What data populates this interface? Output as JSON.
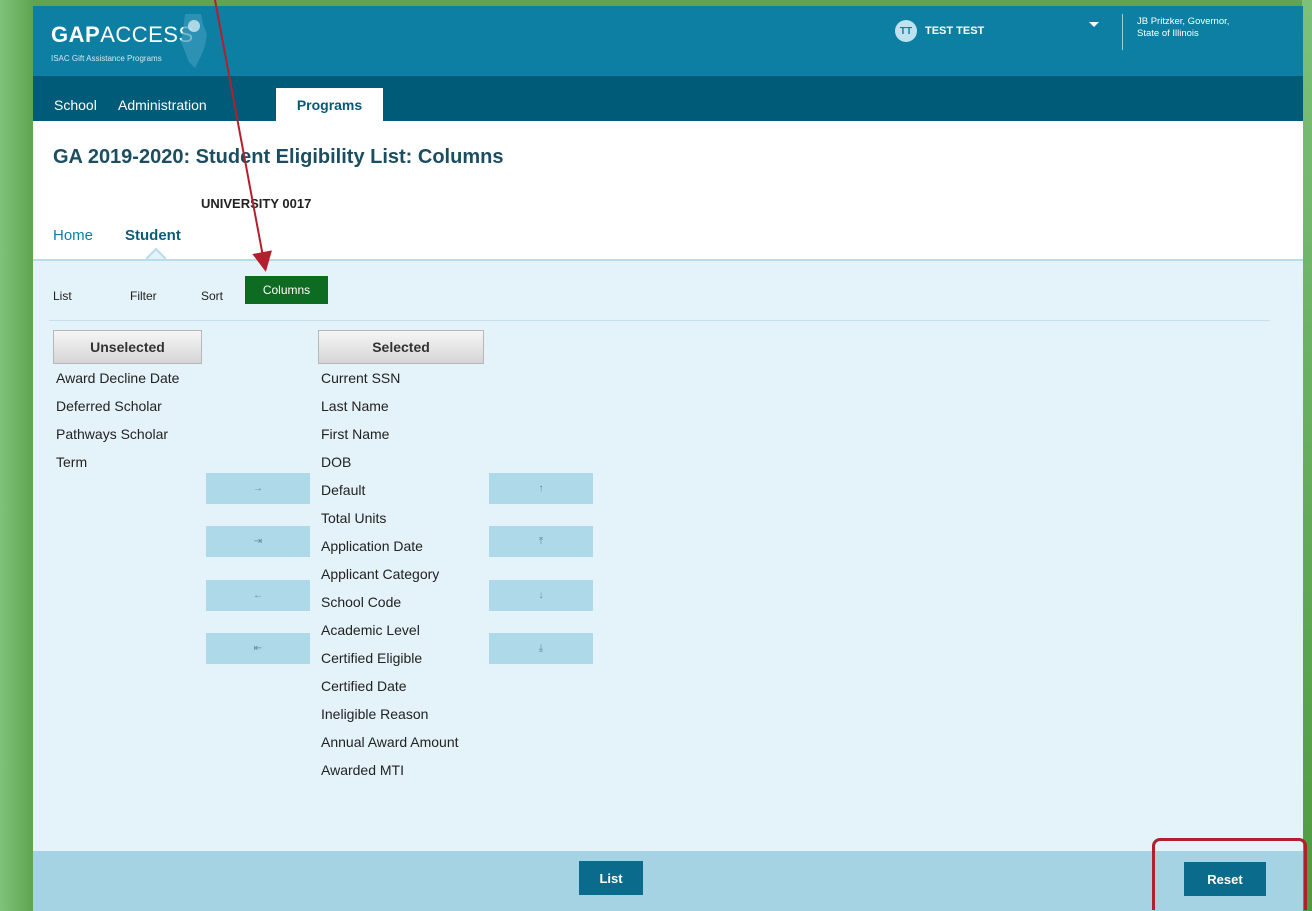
{
  "header": {
    "logo_brand_bold": "GAP",
    "logo_brand_rest": "ACCESS",
    "logo_subtitle": "ISAC Gift Assistance Programs",
    "user_initials": "TT",
    "user_name": "TEST TEST",
    "governor_line1": "JB Pritzker, Governor,",
    "governor_line2": "State of Illinois"
  },
  "nav": {
    "school": "School",
    "administration": "Administration",
    "programs": "Programs"
  },
  "page": {
    "title": "GA 2019-2020: Student Eligibility List: Columns",
    "school": "UNIVERSITY 0017",
    "subtab_home": "Home",
    "subtab_student": "Student"
  },
  "subnav": {
    "list": "List",
    "filter": "Filter",
    "sort": "Sort",
    "columns": "Columns"
  },
  "unselected": {
    "header": "Unselected",
    "items": [
      "Award Decline Date",
      "Deferred Scholar",
      "Pathways Scholar",
      "Term"
    ]
  },
  "selected": {
    "header": "Selected",
    "items": [
      "Current SSN",
      "Last Name",
      "First Name",
      "DOB",
      "Default",
      "Total Units",
      "Application Date",
      "Applicant Category",
      "School Code",
      "Academic Level",
      "Certified Eligible",
      "Certified Date",
      "Ineligible Reason",
      "Annual Award Amount",
      "Awarded MTI"
    ]
  },
  "move_buttons": {
    "add": "→",
    "add_all": "⇥",
    "remove": "←",
    "remove_all": "⇤"
  },
  "order_buttons": {
    "up": "↑",
    "top": "⤒",
    "down": "↓",
    "bottom": "⤓"
  },
  "footer": {
    "list": "List",
    "reset": "Reset"
  },
  "colors": {
    "header_blue": "#0c7fa3",
    "nav_dark": "#005b78",
    "active_green": "#0e6b22",
    "annotation_red": "#b21f2d"
  }
}
